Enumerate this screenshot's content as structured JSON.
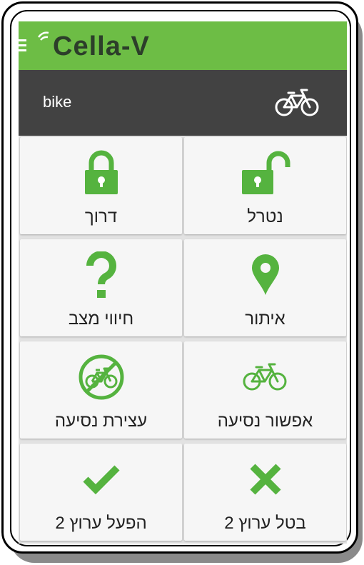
{
  "app": {
    "logo_text": "Cella-V",
    "brand_color": "#6dbd45",
    "icon_color": "#55b33f"
  },
  "device": {
    "name": "bike",
    "icon": "bicycle-icon"
  },
  "tiles": [
    {
      "id": "lock",
      "label": "דרוך",
      "icon": "lock-icon"
    },
    {
      "id": "unlock",
      "label": "נטרל",
      "icon": "unlock-icon"
    },
    {
      "id": "status",
      "label": "חיווי מצב",
      "icon": "question-icon"
    },
    {
      "id": "locate",
      "label": "איתור",
      "icon": "location-pin-icon"
    },
    {
      "id": "block-ride",
      "label": "עצירת נסיעה",
      "icon": "no-bicycle-icon"
    },
    {
      "id": "allow-ride",
      "label": "אפשור נסיעה",
      "icon": "bicycle-icon"
    },
    {
      "id": "enable-channel",
      "label": "הפעל ערוץ 2",
      "icon": "checkmark-icon"
    },
    {
      "id": "cancel-channel",
      "label": "בטל ערוץ 2",
      "icon": "cross-icon"
    }
  ]
}
